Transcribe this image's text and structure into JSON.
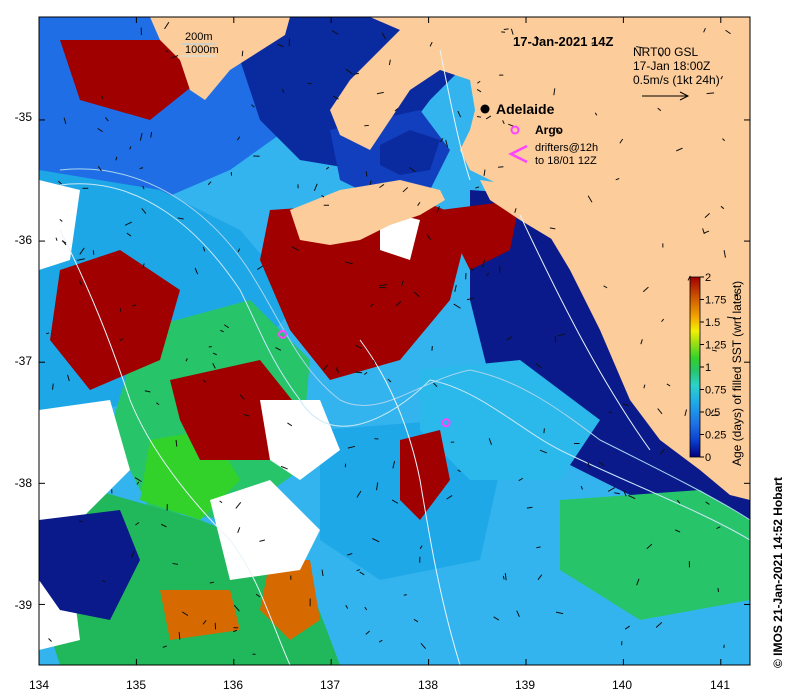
{
  "header": {
    "date_title": "17-Jan-2021 14Z",
    "product": "NRT00 GSL",
    "valid_time": "17-Jan 18:00Z",
    "scale_label": "0.5m/s (1kt 24h)"
  },
  "isobath_labels": [
    "200m",
    "1000m"
  ],
  "places": [
    {
      "name": "Adelaide",
      "lon": 138.6,
      "lat": -34.93
    }
  ],
  "legend": {
    "argo_label": "Argo",
    "drifters_line1": "drifters@12h",
    "drifters_line2": "to 18/01 12Z",
    "argo_color": "#ff44ff",
    "drifter_color": "#ff44ff"
  },
  "argo_floats": [
    {
      "lon": 136.5,
      "lat": -36.77
    },
    {
      "lon": 138.18,
      "lat": -37.5
    }
  ],
  "axes": {
    "lon_range": [
      134,
      141.3
    ],
    "lat_range": [
      -39.5,
      -34.15
    ],
    "x_ticks": [
      "134",
      "135",
      "136",
      "137",
      "138",
      "139",
      "140",
      "141"
    ],
    "y_ticks": [
      "-35",
      "-36",
      "-37",
      "-38",
      "-39"
    ]
  },
  "colorbar": {
    "title": "Age (days) of filled SST (wrt latest)",
    "min": 0,
    "max": 2,
    "tick_labels": [
      "2",
      "1.75",
      "1.5",
      "1.25",
      "1",
      "0.75",
      "0.5",
      "0.25",
      "0"
    ],
    "colors": [
      "#000080",
      "#0a3fcf",
      "#1e6fe6",
      "#1fa8e8",
      "#2bd3c9",
      "#27c46a",
      "#33d22a",
      "#a6e013",
      "#f2f005",
      "#f2a300",
      "#d66a00",
      "#a00000"
    ]
  },
  "colors": {
    "land": "#fccc9a",
    "missing": "#ffffff",
    "deep_ocean": "#0a1a8a"
  },
  "copyright": "© IMOS 21-Jan-2021 14:52 Hobart"
}
